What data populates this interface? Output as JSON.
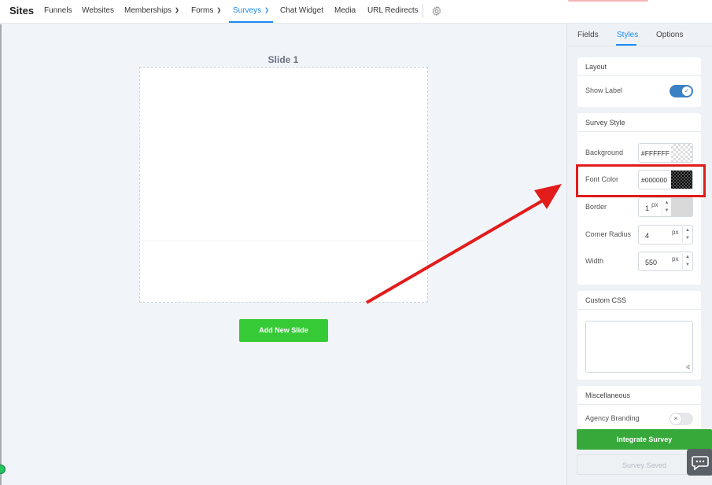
{
  "nav": {
    "brand": "Sites",
    "items": [
      {
        "label": "Funnels",
        "dropdown": false
      },
      {
        "label": "Websites",
        "dropdown": false
      },
      {
        "label": "Memberships",
        "dropdown": true
      },
      {
        "label": "Forms",
        "dropdown": true
      },
      {
        "label": "Surveys",
        "dropdown": true,
        "active": true
      },
      {
        "label": "Chat Widget",
        "dropdown": false
      },
      {
        "label": "Media",
        "dropdown": false
      },
      {
        "label": "URL Redirects",
        "dropdown": false
      }
    ],
    "settings_icon": "gear-icon"
  },
  "canvas": {
    "slide_title": "Slide 1",
    "add_slide_label": "Add New Slide"
  },
  "panel": {
    "tabs": [
      "Fields",
      "Styles",
      "Options"
    ],
    "active_tab": "Styles",
    "layout": {
      "heading": "Layout",
      "show_label": "Show Label",
      "show_label_on": true
    },
    "survey_style": {
      "heading": "Survey Style",
      "background_label": "Background",
      "background_value": "#FFFFFF",
      "font_color_label": "Font Color",
      "font_color_value": "#000000",
      "border_label": "Border",
      "border_value": "1",
      "border_unit": "px",
      "corner_radius_label": "Corner Radius",
      "corner_radius_value": "4",
      "corner_radius_unit": "px",
      "width_label": "Width",
      "width_value": "550",
      "width_unit": "px"
    },
    "custom_css": {
      "heading": "Custom CSS",
      "value": ""
    },
    "misc": {
      "heading": "Miscellaneous",
      "agency_branding": "Agency Branding",
      "agency_branding_on": false
    },
    "integrate_label": "Integrate Survey",
    "saved_label": "Survey Saved"
  },
  "colors": {
    "accent": "#188bf6",
    "green": "#37ca37",
    "annotation_red": "#e21b1b"
  }
}
